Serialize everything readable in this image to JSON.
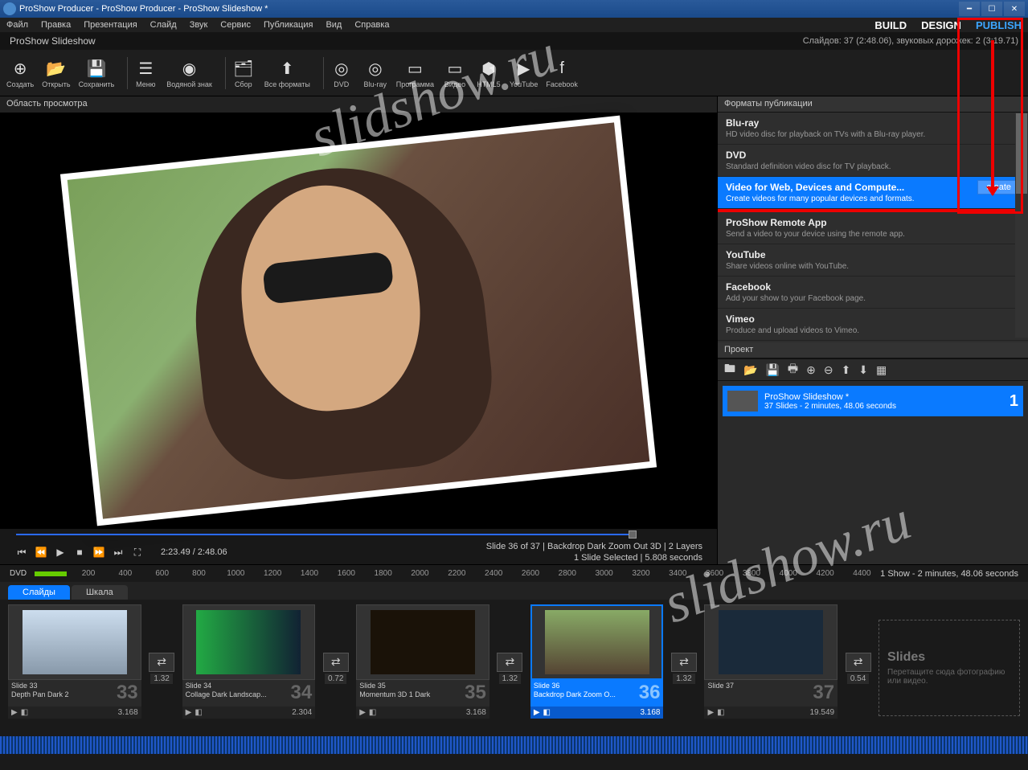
{
  "window": {
    "title": "ProShow Producer - ProShow Producer - ProShow Slideshow *"
  },
  "menu": {
    "items": [
      "Файл",
      "Правка",
      "Презентация",
      "Слайд",
      "Звук",
      "Сервис",
      "Публикация",
      "Вид",
      "Справка"
    ],
    "tabs": [
      "BUILD",
      "DESIGN",
      "PUBLISH"
    ]
  },
  "info": {
    "title": "ProShow Slideshow",
    "status": "Слайдов: 37 (2:48.06), звуковых дорожек: 2 (3:19.71)"
  },
  "toolbar": [
    {
      "label": "Создать",
      "icon": "⊕"
    },
    {
      "label": "Открыть",
      "icon": "📂"
    },
    {
      "label": "Сохранить",
      "icon": "💾"
    },
    {
      "sep": true
    },
    {
      "label": "Меню",
      "icon": "☰"
    },
    {
      "label": "Водяной знак",
      "icon": "◉"
    },
    {
      "sep": true
    },
    {
      "label": "Сбор",
      "icon": "🗂"
    },
    {
      "label": "Все форматы",
      "icon": "⬆"
    },
    {
      "sep": true
    },
    {
      "label": "DVD",
      "icon": "◎"
    },
    {
      "label": "Blu-ray",
      "icon": "◎"
    },
    {
      "label": "Программа",
      "icon": "▭"
    },
    {
      "label": "Видео",
      "icon": "▭"
    },
    {
      "label": "HTML5",
      "icon": "⬢"
    },
    {
      "label": "YouTube",
      "icon": "▶"
    },
    {
      "label": "Facebook",
      "icon": "f"
    }
  ],
  "preview": {
    "header": "Область просмотра",
    "time": "2:23.49 / 2:48.06",
    "info1": "Slide 36 of 37  |  Backdrop Dark Zoom Out 3D  |  2 Layers",
    "info2": "1 Slide Selected  |  5.808 seconds"
  },
  "publish": {
    "header": "Форматы публикации",
    "create": "create",
    "items": [
      {
        "t": "Blu-ray",
        "d": "HD video disc for playback on TVs with a Blu-ray player."
      },
      {
        "t": "DVD",
        "d": "Standard definition video disc for TV playback."
      },
      {
        "t": "Video for Web, Devices and Compute...",
        "d": "Create videos for many popular devices and formats.",
        "sel": true
      },
      {
        "t": "ProShow Remote App",
        "d": "Send a video to your device using the remote app."
      },
      {
        "t": "YouTube",
        "d": "Share videos online with YouTube."
      },
      {
        "t": "Facebook",
        "d": "Add your show to your Facebook page."
      },
      {
        "t": "Vimeo",
        "d": "Produce and upload videos to Vimeo."
      }
    ]
  },
  "project": {
    "header": "Проект",
    "item": {
      "title": "ProShow Slideshow *",
      "sub": "37 Slides - 2 minutes, 48.06 seconds",
      "num": "1"
    }
  },
  "ruler": {
    "label": "DVD",
    "ticks": [
      "200",
      "400",
      "600",
      "800",
      "1000",
      "1200",
      "1400",
      "1600",
      "1800",
      "2000",
      "2200",
      "2400",
      "2600",
      "2800",
      "3000",
      "3200",
      "3400",
      "3600",
      "3800",
      "4000",
      "4200",
      "4400"
    ],
    "showinfo": "1 Show - 2 minutes, 48.06 seconds"
  },
  "tabs": {
    "slides": "Слайды",
    "scale": "Шкала"
  },
  "slides": [
    {
      "n": "Slide 33",
      "st": "Depth Pan Dark 2",
      "big": "33",
      "dur": "3.168",
      "bg": "linear-gradient(#cde,#89a)"
    },
    {
      "n": "Slide 34",
      "st": "Collage Dark Landscap...",
      "big": "34",
      "dur": "2.304",
      "bg": "linear-gradient(90deg,#2a4,#123)"
    },
    {
      "n": "Slide 35",
      "st": "Momentum 3D 1 Dark",
      "big": "35",
      "dur": "3.168",
      "bg": "#1a1208"
    },
    {
      "n": "Slide 36",
      "st": "Backdrop Dark Zoom O...",
      "big": "36",
      "dur": "3.168",
      "bg": "linear-gradient(#8a6,#543)",
      "sel": true
    },
    {
      "n": "Slide 37",
      "st": "",
      "big": "37",
      "dur": "19.549",
      "bg": "#1a2a3a"
    }
  ],
  "transitions": [
    {
      "dur": "1.32"
    },
    {
      "dur": "0.72"
    },
    {
      "dur": "1.32"
    },
    {
      "dur": "1.32"
    },
    {
      "dur": "0.54"
    }
  ],
  "drop": {
    "title": "Slides",
    "text": "Перетащите сюда фотографию или видео."
  },
  "watermark": "slidshow.ru"
}
